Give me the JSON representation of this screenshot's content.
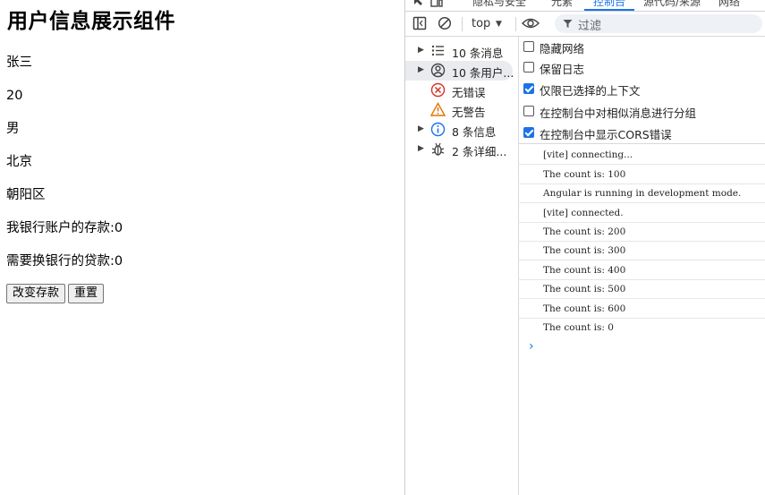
{
  "page": {
    "title": "用户信息展示组件",
    "lines": [
      "张三",
      "20",
      "男",
      "北京",
      "朝阳区",
      "我银行账户的存款:0",
      "需要换银行的贷款:0"
    ],
    "buttons": {
      "change": "改变存款",
      "reset": "重置"
    }
  },
  "devtools": {
    "tabs": [
      "隐私与安全",
      "元素",
      "控制台",
      "源代码/来源",
      "网络"
    ],
    "active_tab": "控制台",
    "toolbar": {
      "context": "top",
      "filter_placeholder": "过滤"
    },
    "sidebar": [
      {
        "label": "10 条消息",
        "icon": "list-icon",
        "expandable": true
      },
      {
        "label": "10 条用户...",
        "icon": "user-icon",
        "expandable": true,
        "selected": true
      },
      {
        "label": "无错误",
        "icon": "error-icon",
        "expandable": false
      },
      {
        "label": "无警告",
        "icon": "warning-icon",
        "expandable": false
      },
      {
        "label": "8 条信息",
        "icon": "info-icon",
        "expandable": true
      },
      {
        "label": "2 条详细...",
        "icon": "bug-icon",
        "expandable": true
      }
    ],
    "options": [
      {
        "label": "隐藏网络",
        "checked": false
      },
      {
        "label": "保留日志",
        "checked": false
      },
      {
        "label": "仅限已选择的上下文",
        "checked": true
      },
      {
        "label": "在控制台中对相似消息进行分组",
        "checked": false
      },
      {
        "label": "在控制台中显示CORS错误",
        "checked": true
      }
    ],
    "logs": [
      "[vite] connecting...",
      "The count is: 100",
      "Angular is running in development mode.",
      "[vite] connected.",
      "The count is: 200",
      "The count is: 300",
      "The count is: 400",
      "The count is: 500",
      "The count is: 600",
      "The count is: 0"
    ],
    "colors": {
      "accent": "#1a73e8",
      "error": "#d93025",
      "warning": "#e37400"
    }
  }
}
